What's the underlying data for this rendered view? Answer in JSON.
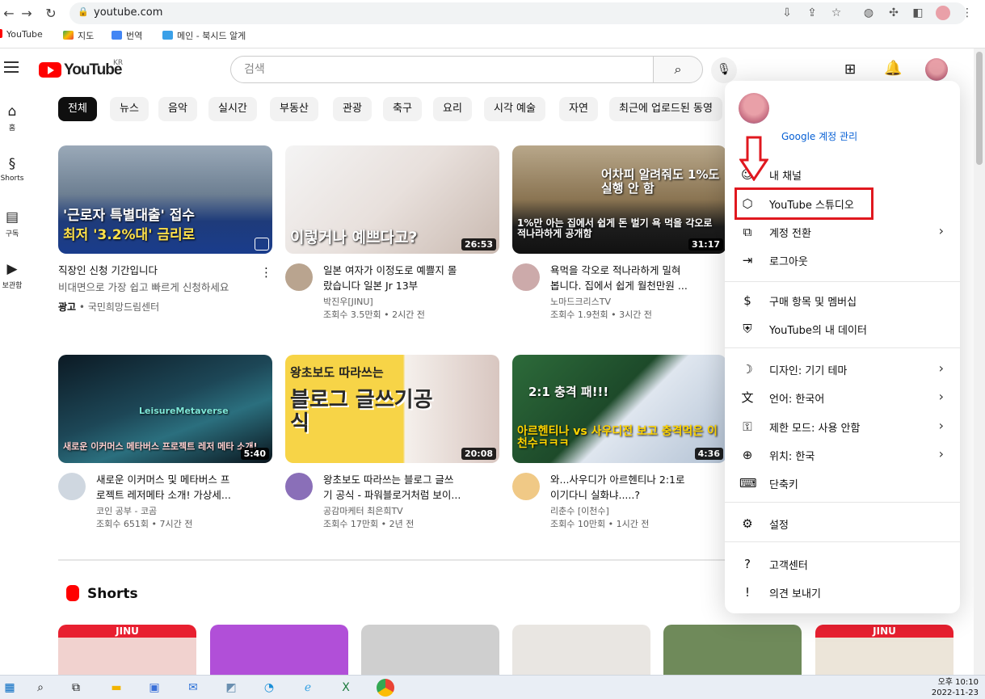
{
  "browser": {
    "url": "youtube.com",
    "bookmarks": [
      "YouTube",
      "지도",
      "번역",
      "메인 - 북시드 알게"
    ]
  },
  "header": {
    "logo_text": "YouTube",
    "region": "KR",
    "search_placeholder": "검색"
  },
  "guide": [
    {
      "label": "홈",
      "icon": "home-icon",
      "glyph": "⌂"
    },
    {
      "label": "Shorts",
      "icon": "shorts-icon",
      "glyph": "§"
    },
    {
      "label": "구독",
      "icon": "subscriptions-icon",
      "glyph": "▤"
    },
    {
      "label": "보관함",
      "icon": "library-icon",
      "glyph": "▶"
    }
  ],
  "chips": [
    "전체",
    "뉴스",
    "음악",
    "실시간",
    "부동산",
    "관광",
    "축구",
    "요리",
    "시각 예술",
    "자연",
    "최근에 업로드된 동영"
  ],
  "videos": [
    {
      "thumb_text_1": "'근로자 특별대출' 접수",
      "thumb_text_2": "최저 '3.2%대' 금리로",
      "duration": "",
      "title_1": "직장인 신청 기간입니다",
      "title_2": "",
      "line2": "비대면으로 가장 쉽고 빠르게 신청하세요",
      "channel": "국민희망드림센터",
      "ad_label": "광고",
      "meta": ""
    },
    {
      "thumb_text_1": "이렇거나 예쁘다고?",
      "thumb_text_2": "",
      "duration": "26:53",
      "title_1": "일본 여자가 이정도로 예쁠지 몰",
      "title_2": "랐습니다 일본 Jr 13부",
      "line2": "",
      "channel": "박진우[JINU]",
      "ad_label": "",
      "meta": "조회수 3.5만회 • 2시간 전"
    },
    {
      "thumb_text_1": "어차피 알려줘도 1%도 실행 안 함",
      "thumb_text_2": "1%만 아는 집에서 쉽게 돈 벌기 욕 먹을 각오로 적나라하게 공개함",
      "duration": "31:17",
      "title_1": "욕먹을 각오로 적나라하게 밀혀",
      "title_2": "봅니다. 집에서 쉽게 월천만원 ...",
      "line2": "",
      "channel": "노마드크리스TV",
      "ad_label": "",
      "meta": "조회수 1.9천회 • 3시간 전"
    },
    {
      "thumb_text_1": "LeisureMetaverse",
      "thumb_text_2": "새로운 이커머스 메타버스 프로젝트 레저 메타 소개!",
      "duration": "5:40",
      "title_1": "새로운 이커머스 및 메타버스 프",
      "title_2": "로젝트 레저메타 소개! 가상세...",
      "line2": "",
      "channel": "코인 공부 - 코곰",
      "ad_label": "",
      "meta": "조회수 651회 • 7시간 전"
    },
    {
      "thumb_text_1": "왕초보도 따라쓰는",
      "thumb_text_2": "블로그 글쓰기공식",
      "duration": "20:08",
      "title_1": "왕초보도 따라쓰는 블로그 글쓰",
      "title_2": "기 공식 - 파워블로거처럼 보이...",
      "line2": "",
      "channel": "공감마케터 최은희TV",
      "ad_label": "",
      "meta": "조회수 17만회 • 2년 전"
    },
    {
      "thumb_text_1": "2:1 충격 패!!!",
      "thumb_text_2": "아르헨티나 vs 사우디전 보고 충격먹은 이천수ㅋㅋㅋ",
      "duration": "4:36",
      "title_1": "와...사우디가 아르헨티나 2:1로",
      "title_2": "이기다니 실화냐.....?",
      "line2": "",
      "channel": "리춘수 [이천수]",
      "ad_label": "",
      "meta": "조회수 10만회 • 1시간 전"
    }
  ],
  "shorts": {
    "title": "Shorts",
    "badges": [
      "JINU",
      "",
      "",
      "",
      "",
      "JINU"
    ]
  },
  "menu": {
    "google_manage": "Google 계정 관리",
    "items": [
      {
        "label": "내 채널",
        "icon": "person-icon",
        "glyph": "☺",
        "arrow": false
      },
      {
        "label": "YouTube 스튜디오",
        "icon": "studio-icon",
        "glyph": "⬡",
        "arrow": false
      },
      {
        "label": "계정 전환",
        "icon": "switch-account-icon",
        "glyph": "⧉",
        "arrow": true
      },
      {
        "label": "로그아웃",
        "icon": "logout-icon",
        "glyph": "⇥",
        "arrow": false
      },
      {
        "label": "구매 항목 및 멤버십",
        "icon": "dollar-icon",
        "glyph": "$",
        "arrow": false
      },
      {
        "label": "YouTube의 내 데이터",
        "icon": "shield-person-icon",
        "glyph": "⛨",
        "arrow": false
      },
      {
        "label": "디자인: 기기 테마",
        "icon": "moon-icon",
        "glyph": "☽",
        "arrow": true
      },
      {
        "label": "언어: 한국어",
        "icon": "translate-icon",
        "glyph": "文",
        "arrow": true
      },
      {
        "label": "제한 모드: 사용 안함",
        "icon": "restricted-icon",
        "glyph": "⚿",
        "arrow": true
      },
      {
        "label": "위치: 한국",
        "icon": "globe-icon",
        "glyph": "⊕",
        "arrow": true
      },
      {
        "label": "단축키",
        "icon": "keyboard-icon",
        "glyph": "⌨",
        "arrow": false
      },
      {
        "label": "설정",
        "icon": "gear-icon",
        "glyph": "⚙",
        "arrow": false
      },
      {
        "label": "고객센터",
        "icon": "help-icon",
        "glyph": "?",
        "arrow": false
      },
      {
        "label": "의견 보내기",
        "icon": "feedback-icon",
        "glyph": "!",
        "arrow": false
      }
    ]
  },
  "taskbar": {
    "time": "오후 10:10",
    "date": "2022-11-23"
  },
  "colors": {
    "yt_red": "#ff0000",
    "highlight_red": "#e0181f",
    "link_blue": "#065fd4"
  }
}
